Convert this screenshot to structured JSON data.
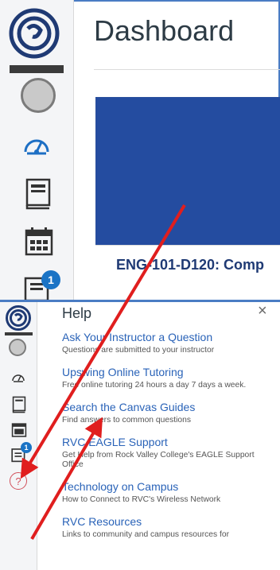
{
  "dashboard": {
    "title": "Dashboard",
    "course_card": {
      "title": "ENG-101-D120: Comp"
    },
    "inbox_badge": "1"
  },
  "help_panel": {
    "title": "Help",
    "close_glyph": "×",
    "inbox_badge": "1",
    "help_icon_glyph": "?",
    "items": [
      {
        "title": "Ask Your Instructor a Question",
        "desc": "Questions are submitted to your instructor"
      },
      {
        "title": "Upswing Online Tutoring",
        "desc": "Free online tutoring 24 hours a day 7 days a week."
      },
      {
        "title": "Search the Canvas Guides",
        "desc": "Find answers to common questions"
      },
      {
        "title": "RVC EAGLE Support",
        "desc": "Get Help from Rock Valley College's EAGLE Support Office"
      },
      {
        "title": "Technology on Campus",
        "desc": "How to Connect to RVC's Wireless Network"
      },
      {
        "title": "RVC Resources",
        "desc": "Links to community and campus resources for"
      }
    ]
  },
  "icons": {
    "logo": "canvas-logo-icon",
    "account": "user-avatar-icon",
    "dashboard": "dashboard-icon",
    "courses": "courses-icon",
    "calendar": "calendar-icon",
    "inbox": "inbox-icon",
    "help": "help-icon"
  },
  "colors": {
    "accent_blue": "#2a63b8",
    "card_blue": "#244ca0",
    "arrow_red": "#e01e1e",
    "frame_blue": "#4a7cc4"
  }
}
